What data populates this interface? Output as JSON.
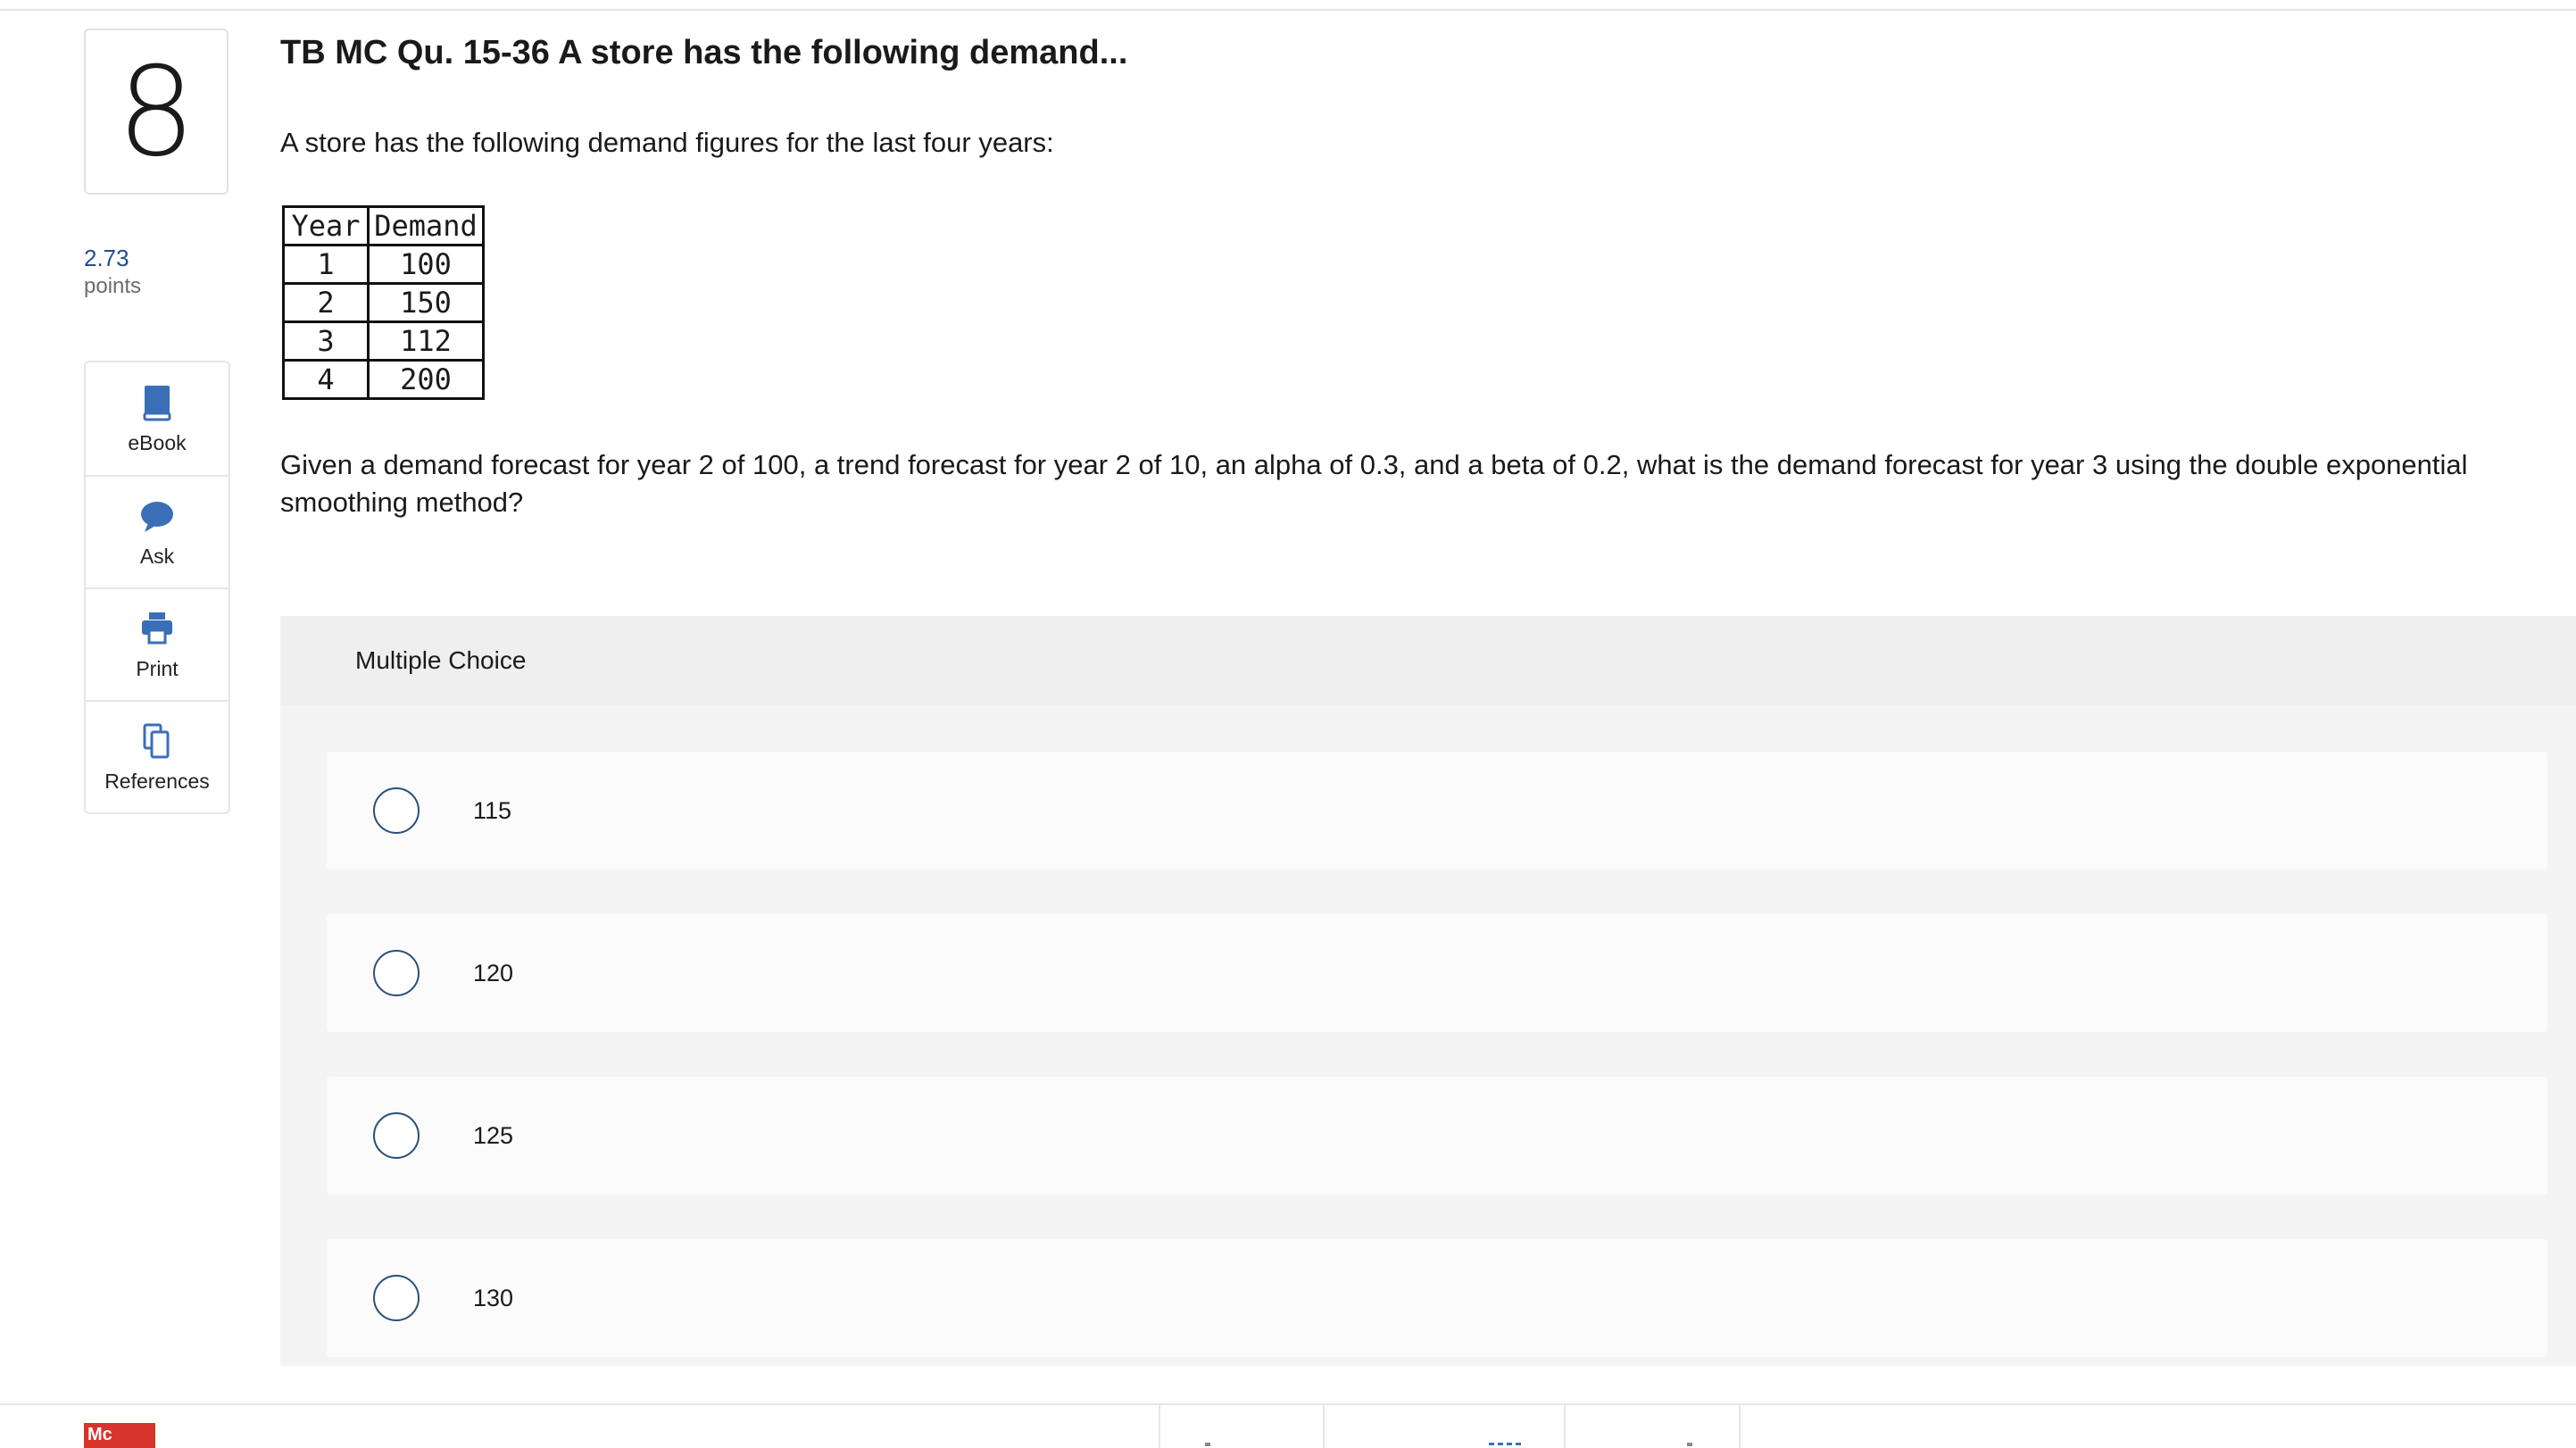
{
  "question": {
    "number": "8",
    "points_value": "2.73",
    "points_label": "points",
    "title": "TB MC Qu. 15-36 A store has the following demand...",
    "intro": "A store has the following demand figures for the last four years:",
    "table": {
      "headers": [
        "Year",
        "Demand"
      ],
      "rows": [
        [
          "1",
          "100"
        ],
        [
          "2",
          "150"
        ],
        [
          "3",
          "112"
        ],
        [
          "4",
          "200"
        ]
      ]
    },
    "text": "Given a demand forecast for year 2 of 100, a trend forecast for year 2 of 10, an alpha of 0.3, and a beta of 0.2, what is the demand forecast for year 3 using the double exponential smoothing method?"
  },
  "tools": {
    "ebook": "eBook",
    "ask": "Ask",
    "print": "Print",
    "references": "References"
  },
  "multiple_choice": {
    "heading": "Multiple Choice",
    "options": [
      "115",
      "120",
      "125",
      "130"
    ]
  },
  "footer": {
    "logo_text": "Mc"
  },
  "colors": {
    "accent_blue": "#2a4f7a",
    "icon_blue": "#3a6fb8",
    "points_blue": "#1f4e8c",
    "logo_red": "#d9342b"
  }
}
